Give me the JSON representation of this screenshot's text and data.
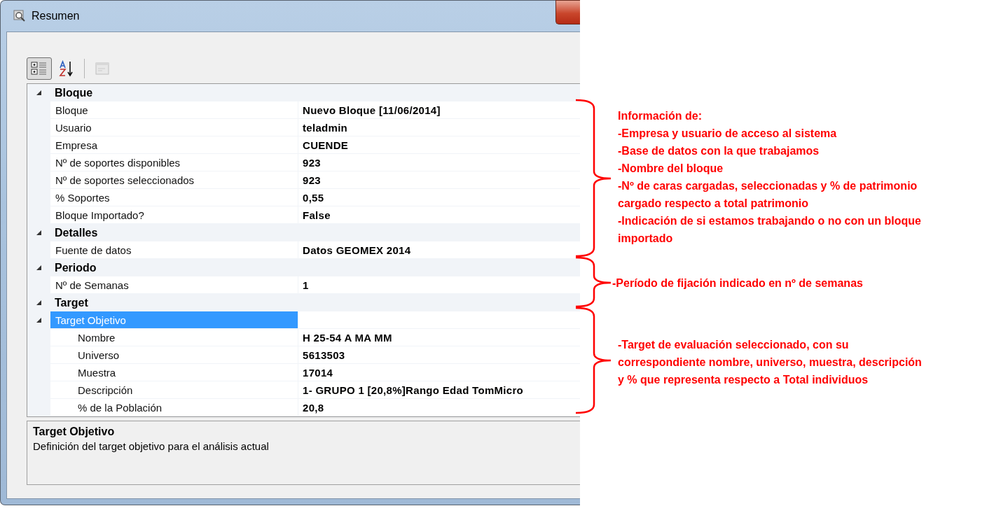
{
  "window": {
    "title": "Resumen"
  },
  "toolbar": [
    {
      "kind": "categorized",
      "selected": true,
      "disabled": false
    },
    {
      "kind": "alphabetical",
      "selected": false,
      "disabled": false
    },
    {
      "kind": "property-pages",
      "selected": false,
      "disabled": true
    }
  ],
  "property_grid": {
    "categories": [
      {
        "name": "Bloque",
        "expanded": true,
        "rows": [
          {
            "label": "Bloque",
            "value": "Nuevo Bloque [11/06/2014]",
            "selected": false
          },
          {
            "label": "Usuario",
            "value": "teladmin",
            "selected": false
          },
          {
            "label": "Empresa",
            "value": "CUENDE",
            "selected": false
          },
          {
            "label": "Nº de soportes disponibles",
            "value": "923",
            "selected": false
          },
          {
            "label": "Nº de soportes seleccionados",
            "value": "923",
            "selected": false
          },
          {
            "label": "% Soportes",
            "value": "0,55",
            "selected": false
          },
          {
            "label": "Bloque Importado?",
            "value": "False",
            "selected": false
          }
        ]
      },
      {
        "name": "Detalles",
        "expanded": true,
        "rows": [
          {
            "label": "Fuente de datos",
            "value": "Datos GEOMEX 2014",
            "selected": false
          }
        ]
      },
      {
        "name": "Periodo",
        "expanded": true,
        "rows": [
          {
            "label": "Nº de Semanas",
            "value": "1",
            "selected": false
          }
        ]
      },
      {
        "name": "Target",
        "expanded": true,
        "rows": [
          {
            "label": "Target Objetivo",
            "selected": true,
            "expanded": true,
            "children": [
              {
                "label": "Nombre",
                "value": "H 25-54 A MA MM",
                "selected": false
              },
              {
                "label": "Universo",
                "value": "5613503",
                "selected": false
              },
              {
                "label": "Muestra",
                "value": "17014",
                "selected": false
              },
              {
                "label": "Descripción",
                "value": "1- GRUPO 1 [20,8%]Rango Edad TomMicro",
                "selected": false
              },
              {
                "label": "% de la Población",
                "value": "20,8",
                "selected": false
              }
            ]
          }
        ]
      }
    ]
  },
  "description": {
    "title": "Target Objetivo",
    "text": "Definición del target objetivo para el análisis actual"
  },
  "annotations": [
    {
      "lines": [
        "Información de:",
        "-Empresa y usuario de acceso al sistema",
        "-Base de datos con la que trabajamos",
        "-Nombre del bloque",
        "-Nº de caras cargadas, seleccionadas y % de patrimonio",
        "cargado respecto a total patrimonio",
        "-Indicación de si estamos trabajando o no con un bloque",
        "importado"
      ]
    },
    {
      "lines": [
        "-Período de fijación indicado en nº de semanas"
      ]
    },
    {
      "lines": [
        "-Target de evaluación seleccionado, con su",
        "correspondiente nombre, universo, muestra, descripción",
        "y % que representa respecto a Total individuos"
      ]
    }
  ]
}
